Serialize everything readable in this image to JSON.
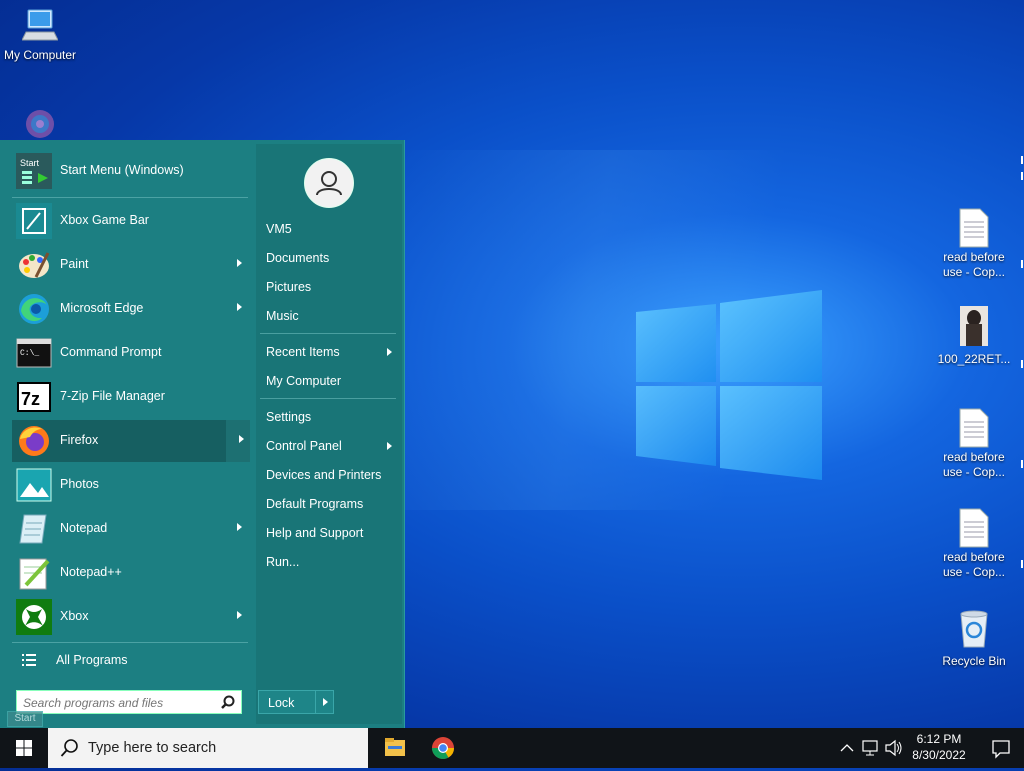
{
  "desktop": {
    "icons": [
      {
        "id": "my-computer",
        "label": "My Computer"
      },
      {
        "id": "doc-1",
        "label": "read before use - Cop..."
      },
      {
        "id": "photo",
        "label": "100_22RET..."
      },
      {
        "id": "doc-2",
        "label": "read before use - Cop..."
      },
      {
        "id": "doc-3",
        "label": "read before use - Cop..."
      },
      {
        "id": "recycle-bin",
        "label": "Recycle Bin"
      }
    ],
    "start_tooltip": "Start"
  },
  "start_menu": {
    "programs": [
      {
        "label": "Start Menu (Windows)",
        "icon": "start-menu-icon",
        "submenu": false
      },
      {
        "label": "Xbox Game Bar",
        "icon": "xbox-game-bar-icon",
        "submenu": false
      },
      {
        "label": "Paint",
        "icon": "paint-icon",
        "submenu": true
      },
      {
        "label": "Microsoft Edge",
        "icon": "edge-icon",
        "submenu": true
      },
      {
        "label": "Command Prompt",
        "icon": "command-prompt-icon",
        "submenu": false
      },
      {
        "label": "7-Zip File Manager",
        "icon": "7zip-icon",
        "submenu": false
      },
      {
        "label": "Firefox",
        "icon": "firefox-icon",
        "submenu": true,
        "highlighted": true
      },
      {
        "label": "Photos",
        "icon": "photos-icon",
        "submenu": false
      },
      {
        "label": "Notepad",
        "icon": "notepad-icon",
        "submenu": true
      },
      {
        "label": "Notepad++",
        "icon": "notepad-plus-plus-icon",
        "submenu": false
      },
      {
        "label": "Xbox",
        "icon": "xbox-icon",
        "submenu": true
      }
    ],
    "all_programs": "All Programs",
    "search_placeholder": "Search programs and files",
    "right_items": [
      {
        "label": "VM5",
        "submenu": false
      },
      {
        "label": "Documents",
        "submenu": false
      },
      {
        "label": "Pictures",
        "submenu": false
      },
      {
        "label": "Music",
        "submenu": false
      },
      {
        "label": "Recent Items",
        "submenu": true
      },
      {
        "label": "My Computer",
        "submenu": false
      },
      {
        "label": "Settings",
        "submenu": false
      },
      {
        "label": "Control Panel",
        "submenu": true
      },
      {
        "label": "Devices and Printers",
        "submenu": false
      },
      {
        "label": "Default Programs",
        "submenu": false
      },
      {
        "label": "Help and Support",
        "submenu": false
      },
      {
        "label": "Run...",
        "submenu": false
      }
    ],
    "lock_label": "Lock",
    "start_icon_text": "Start",
    "cmd_icon_text": "C:\\_",
    "zip_icon_text": "7z"
  },
  "taskbar": {
    "search_placeholder": "Type here to search",
    "time": "6:12 PM",
    "date": "8/30/2022",
    "colors": {
      "bar": "#101418",
      "menu": "#1c7f82",
      "accent": "#0a4fc8"
    }
  }
}
